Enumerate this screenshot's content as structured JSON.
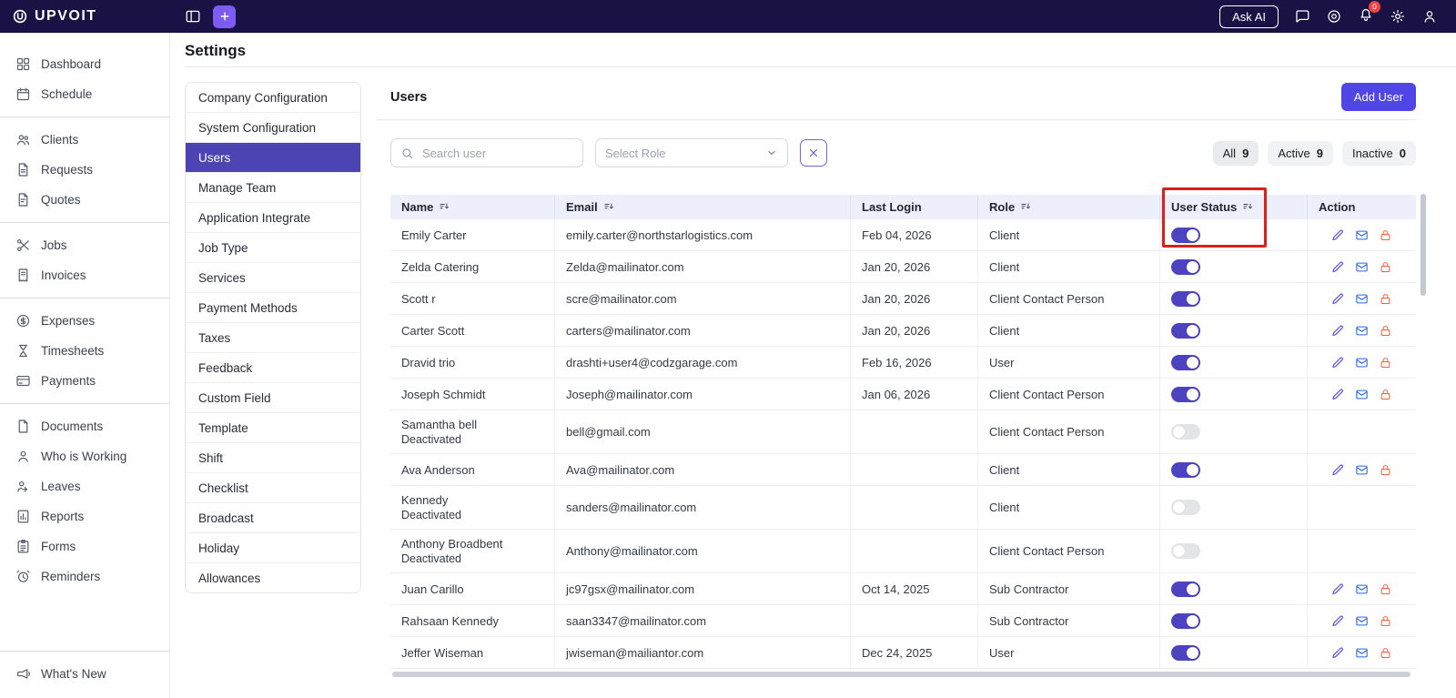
{
  "topbar": {
    "logo_text": "UPVOIT",
    "ask_ai_label": "Ask AI",
    "notification_badge": "0"
  },
  "page": {
    "title": "Settings"
  },
  "sidebar": {
    "groups": [
      {
        "items": [
          {
            "label": "Dashboard",
            "icon": "dashboard"
          },
          {
            "label": "Schedule",
            "icon": "calendar"
          }
        ]
      },
      {
        "items": [
          {
            "label": "Clients",
            "icon": "clients"
          },
          {
            "label": "Requests",
            "icon": "request"
          },
          {
            "label": "Quotes",
            "icon": "quote"
          }
        ]
      },
      {
        "items": [
          {
            "label": "Jobs",
            "icon": "jobs"
          },
          {
            "label": "Invoices",
            "icon": "invoice"
          }
        ]
      },
      {
        "items": [
          {
            "label": "Expenses",
            "icon": "expense"
          },
          {
            "label": "Timesheets",
            "icon": "timesheet"
          },
          {
            "label": "Payments",
            "icon": "payment"
          }
        ]
      },
      {
        "items": [
          {
            "label": "Documents",
            "icon": "document"
          },
          {
            "label": "Who is Working",
            "icon": "who-is-working"
          },
          {
            "label": "Leaves",
            "icon": "leaves"
          },
          {
            "label": "Reports",
            "icon": "reports"
          },
          {
            "label": "Forms",
            "icon": "forms"
          },
          {
            "label": "Reminders",
            "icon": "reminders"
          }
        ]
      },
      {
        "pinned": true,
        "items": [
          {
            "label": "What's New",
            "icon": "whats-new"
          }
        ]
      }
    ]
  },
  "settings_nav": {
    "active_index": 2,
    "items": [
      "Company Configuration",
      "System Configuration",
      "Users",
      "Manage Team",
      "Application Integrate",
      "Job Type",
      "Services",
      "Payment Methods",
      "Taxes",
      "Feedback",
      "Custom Field",
      "Template",
      "Shift",
      "Checklist",
      "Broadcast",
      "Holiday",
      "Allowances"
    ]
  },
  "users_panel": {
    "title": "Users",
    "add_user_label": "Add User",
    "search_placeholder": "Search user",
    "role_placeholder": "Select Role",
    "filters": [
      {
        "label": "All",
        "count": "9"
      },
      {
        "label": "Active",
        "count": "9"
      },
      {
        "label": "Inactive",
        "count": "0"
      }
    ]
  },
  "table": {
    "columns": [
      {
        "label": "Name",
        "sortable": true
      },
      {
        "label": "Email",
        "sortable": true
      },
      {
        "label": "Last Login",
        "sortable": false
      },
      {
        "label": "Role",
        "sortable": true
      },
      {
        "label": "User Status",
        "sortable": true
      },
      {
        "label": "Action",
        "sortable": false
      }
    ],
    "rows": [
      {
        "name": "Emily Carter",
        "sub": "",
        "email": "emily.carter@northstarlogistics.com",
        "last_login": "Feb 04, 2026",
        "role": "Client",
        "status_on": true,
        "has_actions": true
      },
      {
        "name": "Zelda Catering",
        "sub": "",
        "email": "Zelda@mailinator.com",
        "last_login": "Jan 20, 2026",
        "role": "Client",
        "status_on": true,
        "has_actions": true
      },
      {
        "name": "Scott r",
        "sub": "",
        "email": "scre@mailinator.com",
        "last_login": "Jan 20, 2026",
        "role": "Client Contact Person",
        "status_on": true,
        "has_actions": true
      },
      {
        "name": "Carter Scott",
        "sub": "",
        "email": "carters@mailinator.com",
        "last_login": "Jan 20, 2026",
        "role": "Client",
        "status_on": true,
        "has_actions": true
      },
      {
        "name": "Dravid trio",
        "sub": "",
        "email": "drashti+user4@codzgarage.com",
        "last_login": "Feb 16, 2026",
        "role": "User",
        "status_on": true,
        "has_actions": true
      },
      {
        "name": "Joseph Schmidt",
        "sub": "",
        "email": "Joseph@mailinator.com",
        "last_login": "Jan 06, 2026",
        "role": "Client Contact Person",
        "status_on": true,
        "has_actions": true
      },
      {
        "name": "Samantha bell",
        "sub": "Deactivated",
        "email": "bell@gmail.com",
        "last_login": "",
        "role": "Client Contact Person",
        "status_on": false,
        "has_actions": false
      },
      {
        "name": "Ava Anderson",
        "sub": "",
        "email": "Ava@mailinator.com",
        "last_login": "",
        "role": "Client",
        "status_on": true,
        "has_actions": true
      },
      {
        "name": "Kennedy",
        "sub": "Deactivated",
        "email": "sanders@mailinator.com",
        "last_login": "",
        "role": "Client",
        "status_on": false,
        "has_actions": false
      },
      {
        "name": "Anthony Broadbent",
        "sub": "Deactivated",
        "email": "Anthony@mailinator.com",
        "last_login": "",
        "role": "Client Contact Person",
        "status_on": false,
        "has_actions": false
      },
      {
        "name": "Juan Carillo",
        "sub": "",
        "email": "jc97gsx@mailinator.com",
        "last_login": "Oct 14, 2025",
        "role": "Sub Contractor",
        "status_on": true,
        "has_actions": true
      },
      {
        "name": "Rahsaan Kennedy",
        "sub": "",
        "email": "saan3347@mailinator.com",
        "last_login": "",
        "role": "Sub Contractor",
        "status_on": true,
        "has_actions": true
      },
      {
        "name": "Jeffer Wiseman",
        "sub": "",
        "email": "jwiseman@mailiantor.com",
        "last_login": "Dec 24, 2025",
        "role": "User",
        "status_on": true,
        "has_actions": true
      }
    ]
  },
  "colors": {
    "topbar_bg": "#1a1145",
    "accent": "#4f46e5",
    "active_settings_nav_bg": "#4c44b3",
    "toggle_on": "#4d43c0",
    "toggle_off": "#e3e5e9",
    "table_header_bg": "#edeffa",
    "notification_badge_bg": "#ef4444",
    "edit_icon": "#4f46e5",
    "mail_icon": "#2563eb",
    "lock_icon": "#f2643f",
    "annotation_red": "#e01e14"
  }
}
